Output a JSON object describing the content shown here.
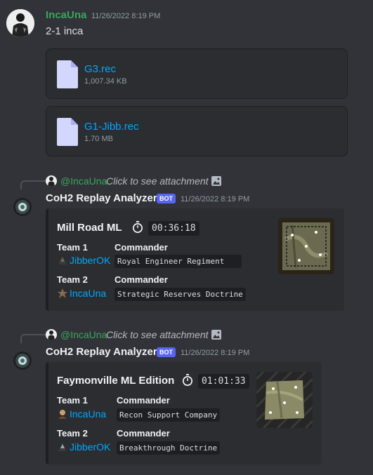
{
  "message1": {
    "username": "IncaUna",
    "username_color": "#3ba55c",
    "timestamp": "11/26/2022 8:19 PM",
    "text": "2-1 inca",
    "attachments": [
      {
        "name": "G3.rec",
        "size": "1,007.34 KB"
      },
      {
        "name": "G1-Jibb.rec",
        "size": "1.70 MB"
      }
    ]
  },
  "bot_messages": [
    {
      "reply": {
        "mention": "@IncaUna",
        "text": "Click to see attachment"
      },
      "bot_name": "CoH2 Replay Analyzer",
      "badge": "BOT",
      "timestamp": "11/26/2022 8:19 PM",
      "embed": {
        "map_name": "Mill Road ML",
        "duration": "00:36:18",
        "team1_label": "Team 1",
        "team2_label": "Team 2",
        "commander_label": "Commander",
        "team1_player": "JibberOK",
        "team1_commander": "Royal Engineer Regiment",
        "team2_player": "IncaUna",
        "team2_commander": "Strategic Reserves Doctrine"
      }
    },
    {
      "reply": {
        "mention": "@IncaUna",
        "text": "Click to see attachment"
      },
      "bot_name": "CoH2 Replay Analyzer",
      "badge": "BOT",
      "timestamp": "11/26/2022 8:19 PM",
      "embed": {
        "map_name": "Faymonville ML Edition",
        "duration": "01:01:33",
        "team1_label": "Team 1",
        "team2_label": "Team 2",
        "commander_label": "Commander",
        "team1_player": "IncaUna",
        "team1_commander": "Recon Support Company",
        "team2_player": "JibberOK",
        "team2_commander": "Breakthrough Doctrine"
      }
    }
  ],
  "colors": {
    "background": "#313338",
    "embed_background": "#2b2d31",
    "link": "#00a8fc",
    "mention": "#3ba55c",
    "bot_badge": "#5865f2"
  }
}
